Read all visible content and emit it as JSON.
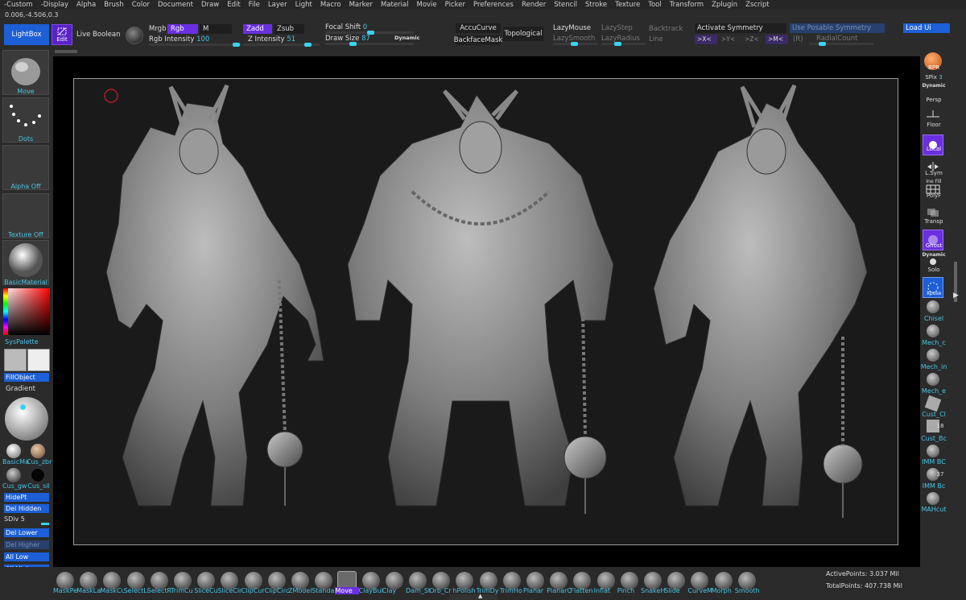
{
  "menu": [
    "-Custom",
    "-Display",
    "Alpha",
    "Brush",
    "Color",
    "Document",
    "Draw",
    "Edit",
    "File",
    "Layer",
    "Light",
    "Macro",
    "Marker",
    "Material",
    "Movie",
    "Picker",
    "Preferences",
    "Render",
    "Stencil",
    "Stroke",
    "Texture",
    "Tool",
    "Transform",
    "Zplugin",
    "Zscript"
  ],
  "coords": "0.006,-4.506,0.3",
  "toolbar": {
    "lightbox": "LightBox",
    "edit": "Edit",
    "live_boolean": "Live Boolean",
    "mrgb": "Mrgb",
    "rgb": "Rgb",
    "m": "M",
    "rgb_intensity_label": "Rgb Intensity",
    "rgb_intensity_value": "100",
    "zadd": "Zadd",
    "zsub": "Zsub",
    "z_intensity_label": "Z Intensity",
    "z_intensity_value": "51",
    "focal_shift_label": "Focal Shift",
    "focal_shift_value": "0",
    "draw_size_label": "Draw Size",
    "draw_size_value": "87",
    "dynamic": "Dynamic",
    "accucurve": "AccuCurve",
    "backfacemask": "BackfaceMask",
    "topological": "Topological",
    "lazymouse": "LazyMouse",
    "lazystep": "LazyStep",
    "lazysmooth": "LazySmooth",
    "lazyradius": "LazyRadius",
    "backtrack": "Backtrack",
    "line": "Line",
    "activate_symmetry": "Activate Symmetry",
    "posable_symmetry": "Use Posable Symmetry",
    "sym_x": ">X<",
    "sym_y": ">Y<",
    "sym_z": ">Z<",
    "sym_m": ">M<",
    "sym_r": "(R)",
    "radial_count": "RadialCount",
    "load_ui": "Load Ui"
  },
  "left_shelf": {
    "brush": "Move",
    "stroke": "Dots",
    "alpha": "Alpha Off",
    "texture": "Texture Off",
    "material": "BasicMaterial",
    "syspalette": "SysPalette",
    "fillobject": "FillObject",
    "gradient": "Gradient",
    "mat1": "BasicMa",
    "mat2": "Cus_zbr",
    "mat3": "Cus_gw",
    "mat4": "Cus_sil",
    "hidept": "HidePt",
    "delhidden": "Del Hidden",
    "sdiv_label": "SDiv",
    "sdiv_value": "5",
    "dellower": "Del Lower",
    "delhigher": "Del Higher",
    "alllow": "All Low",
    "allhigh": "All High"
  },
  "right_shelf": {
    "bpr": "BPR",
    "spix_label": "SPix",
    "spix_value": "3",
    "dynamic": "Dynamic",
    "persp": "Persp",
    "floor": "Floor",
    "local": "Local",
    "lsym": "L.Sym",
    "ine_fill": "Ine Fill",
    "polyf": "PolyF",
    "transp": "Transp",
    "ghost": "Ghost",
    "dynamic2": "Dynamic",
    "solo": "Solo",
    "xpose": "Xpose",
    "chisel": "Chisel",
    "mech_c": "Mech_c",
    "mech_in": "Mech_in",
    "mech_e": "Mech_e",
    "cust_cl": "Cust_Cl",
    "cust_bc": "Cust_Bc",
    "num18": "18",
    "imm_bc1": "IMM BC",
    "num37": "37",
    "imm_bc2": "IMM Bc",
    "mahcut": "MAHcut"
  },
  "bottom_brushes": [
    "MaskPe",
    "MaskLa",
    "MaskCu",
    "SelectLa",
    "SelectRe",
    "TrimCu",
    "SliceCu",
    "SliceCir",
    "ClipCur",
    "ClipCirc",
    "ZModel",
    "Standar",
    "Move",
    "ClayBui",
    "Clay",
    "Dam_St",
    "Orb_Cr",
    "hPolish",
    "TrimDy",
    "TrimHo",
    "Planar",
    "PlanarC",
    "Flatten",
    "Inflat",
    "Pinch",
    "SnakeH",
    "Slide",
    "CurveM",
    "Morph",
    "Smooth"
  ],
  "stats": {
    "active_label": "ActivePoints:",
    "active_value": "3.037 Mil",
    "total_label": "TotalPoints:",
    "total_value": "407.738 Mil"
  }
}
